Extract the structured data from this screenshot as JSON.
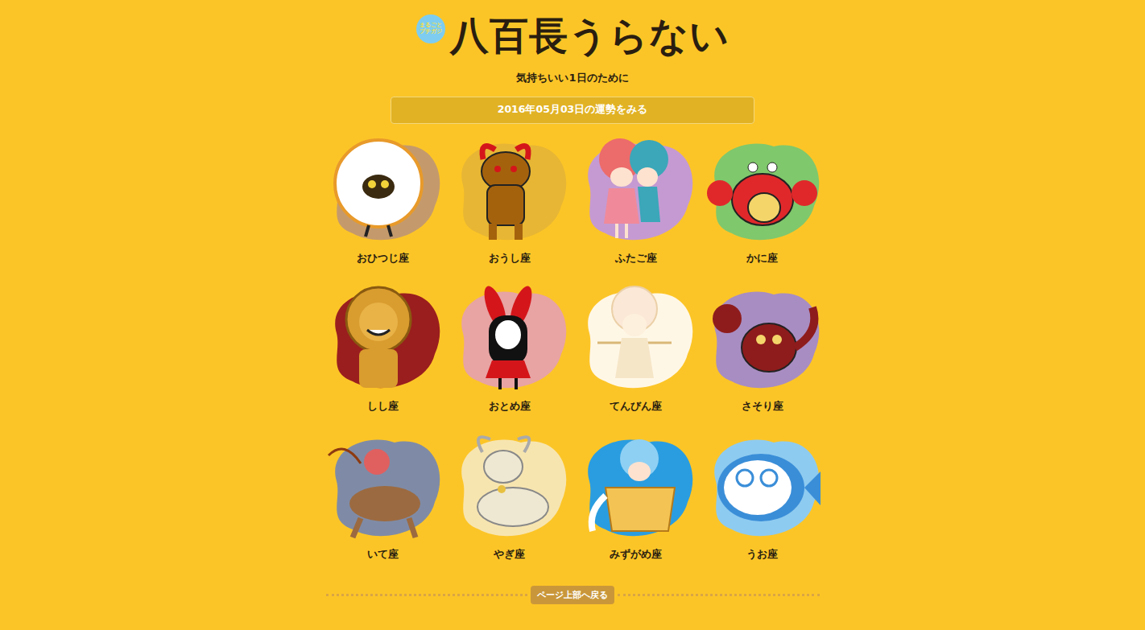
{
  "site": {
    "badge": [
      "まるごと",
      "プチガジ"
    ],
    "title": "八百長うらない",
    "tagline": "気持ちいい1日のために",
    "fortune_button": "2016年05月03日の運勢をみる"
  },
  "signs": [
    {
      "label": "おひつじ座",
      "color": "#c49a6c"
    },
    {
      "label": "おうし座",
      "color": "#e7b634"
    },
    {
      "label": "ふたご座",
      "color": "#c59ad2"
    },
    {
      "label": "かに座",
      "color": "#7fc86c"
    },
    {
      "label": "しし座",
      "color": "#9a1e1e"
    },
    {
      "label": "おとめ座",
      "color": "#e8a3a3"
    },
    {
      "label": "てんびん座",
      "color": "#fff7e6"
    },
    {
      "label": "さそり座",
      "color": "#a88dc2"
    },
    {
      "label": "いて座",
      "color": "#7f8ba6"
    },
    {
      "label": "やぎ座",
      "color": "#f7e5b0"
    },
    {
      "label": "みずがめ座",
      "color": "#2a9de0"
    },
    {
      "label": "うお座",
      "color": "#8ecbf0"
    }
  ],
  "footer": {
    "back_to_top": "ページ上部へ戻る"
  }
}
